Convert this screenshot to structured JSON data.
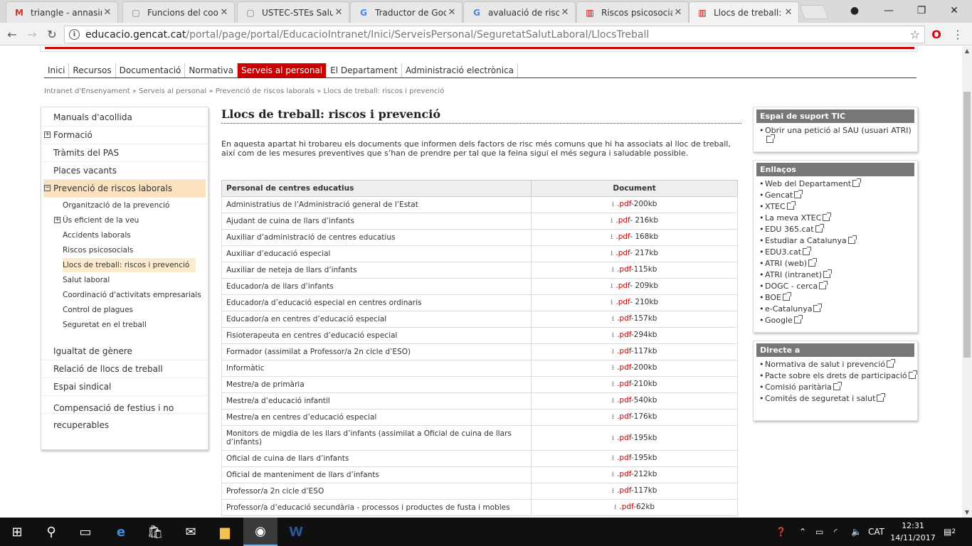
{
  "browser": {
    "tabs": [
      {
        "label": "triangle - annasind",
        "icon": "gmail-icon",
        "color": "#d93025",
        "glyph": "M"
      },
      {
        "label": "Funcions del coord",
        "icon": "doc-icon",
        "color": "#777777",
        "glyph": "▢"
      },
      {
        "label": "USTEC-STEs Salut",
        "icon": "doc-icon",
        "color": "#777777",
        "glyph": "▢"
      },
      {
        "label": "Traductor de Goog",
        "icon": "google-translate-icon",
        "color": "#4285f4",
        "glyph": "G"
      },
      {
        "label": "avaluació de riscos",
        "icon": "google-icon",
        "color": "#4285f4",
        "glyph": "G"
      },
      {
        "label": "Riscos psicosocials",
        "icon": "gencat-icon",
        "color": "#c00000",
        "glyph": "▥"
      },
      {
        "label": "Llocs de treball: ris",
        "icon": "gencat-icon",
        "color": "#c00000",
        "glyph": "▥"
      }
    ],
    "url_domain": "educacio.gencat.cat",
    "url_path": "/portal/page/portal/EducacioIntranet/Inici/ServeisPersonal/SeguretatSalutLaboral/LlocsTreball"
  },
  "mainnav": [
    "Inici",
    "Recursos",
    "Documentació",
    "Normativa",
    "Serveis al personal",
    "El Departament",
    "Administració electrònica"
  ],
  "breadcrumb": "Intranet d'Ensenyament » Serveis al personal » Prevenció de riscos laborals » Llocs de treball: riscos i prevenció",
  "sidebar": {
    "items_top": [
      "Manuals d'acollida",
      "Formació",
      "Tràmits del PAS",
      "Places vacants"
    ],
    "open_item": "Prevenció de riscos laborals",
    "sub_items": [
      "Organització de la prevenció",
      "Ús eficient de la veu",
      "Accidents laborals",
      "Riscos psicosocials",
      "Llocs de treball: riscos i prevenció",
      "Salut laboral",
      "Coordinació d'activitats empresarials",
      "Control de plagues",
      "Seguretat en el treball"
    ],
    "items_bottom": [
      "Igualtat de gènere",
      "Relació de llocs de treball",
      "Espai sindical",
      "Compensació de festius i no recuperables"
    ]
  },
  "content": {
    "title": "Llocs de treball: riscos i prevenció",
    "intro": "En aquesta apartat hi trobareu els documents que informen dels factors de risc més comuns que hi ha associats al lloc de treball, així com de les mesures preventives que s’han de prendre per tal que la feina sigui el més segura i saludable possible.",
    "table": {
      "headers": [
        "Personal de centres educatius",
        "Document"
      ],
      "rows": [
        {
          "name": "Administratius de l’Administració general de l’Estat",
          "ext": ".pdf",
          "size": "-200kb"
        },
        {
          "name": "Ajudant de cuina de llars d’infants",
          "ext": ".pdf",
          "size": "- 216kb"
        },
        {
          "name": "Auxiliar d’administració de centres educatius",
          "ext": ".pdf",
          "size": "- 168kb"
        },
        {
          "name": "Auxiliar d’educació especial",
          "ext": ".pdf",
          "size": "- 217kb"
        },
        {
          "name": "Auxiliar de neteja de llars d’infants",
          "ext": ".pdf",
          "size": "-115kb"
        },
        {
          "name": "Educador/a de llars d’infants",
          "ext": ".pdf",
          "size": "- 209kb"
        },
        {
          "name": "Educador/a d’educació especial en centres ordinaris",
          "ext": ".pdf",
          "size": "- 210kb"
        },
        {
          "name": "Educador/a en centres d’educació especial",
          "ext": ".pdf",
          "size": "-157kb"
        },
        {
          "name": "Fisioterapeuta en centres d’educació especial",
          "ext": ".pdf",
          "size": "-294kb"
        },
        {
          "name": "Formador (assimilat a Professor/a 2n cicle d’ESO)",
          "ext": ".pdf",
          "size": "-117kb"
        },
        {
          "name": "Informàtic",
          "ext": ".pdf",
          "size": "-200kb"
        },
        {
          "name": "Mestre/a de primària",
          "ext": ".pdf",
          "size": "-210kb"
        },
        {
          "name": "Mestre/a d’educació infantil",
          "ext": ".pdf",
          "size": "-540kb"
        },
        {
          "name": "Mestre/a en centres d’educació especial",
          "ext": ".pdf",
          "size": "-176kb"
        },
        {
          "name": "Monitors de migdia de les llars d’infants (assimilat a Oficial de cuina de llars d’infants)",
          "ext": ".pdf",
          "size": "-195kb"
        },
        {
          "name": "Oficial de cuina de llars d’infants",
          "ext": ".pdf",
          "size": "-195kb"
        },
        {
          "name": "Oficial de manteniment de llars d’infants",
          "ext": ".pdf",
          "size": "-212kb"
        },
        {
          "name": "Professor/a 2n cicle d’ESO",
          "ext": ".pdf",
          "size": "-117kb"
        },
        {
          "name": "Professor/a d’educació secundària - processos i productes de fusta i mobles",
          "ext": ".pdf",
          "size": "-62kb"
        }
      ]
    }
  },
  "right": {
    "suport": {
      "title": "Espai de suport TIC",
      "items": [
        "Obrir una petició al SAU (usuari ATRI)"
      ]
    },
    "enllacos": {
      "title": "Enllaços",
      "items": [
        "Web del Departament",
        "Gencat",
        "XTEC",
        "La meva XTEC",
        "EDU 365.cat",
        "Estudiar a Catalunya",
        "EDU3.cat",
        "ATRI (web)",
        "ATRI (intranet)",
        "DOGC - cerca",
        "BOE",
        "e-Catalunya",
        "Google"
      ]
    },
    "directe": {
      "title": "Directe a",
      "items": [
        "Normativa de salut i prevenció",
        "Pacte sobre els drets de participació",
        "Comisió paritària",
        "Comités de seguretat i salut"
      ]
    }
  },
  "taskbar": {
    "lang": "CAT",
    "time": "12:31",
    "date": "14/11/2017",
    "notifications": "2"
  }
}
